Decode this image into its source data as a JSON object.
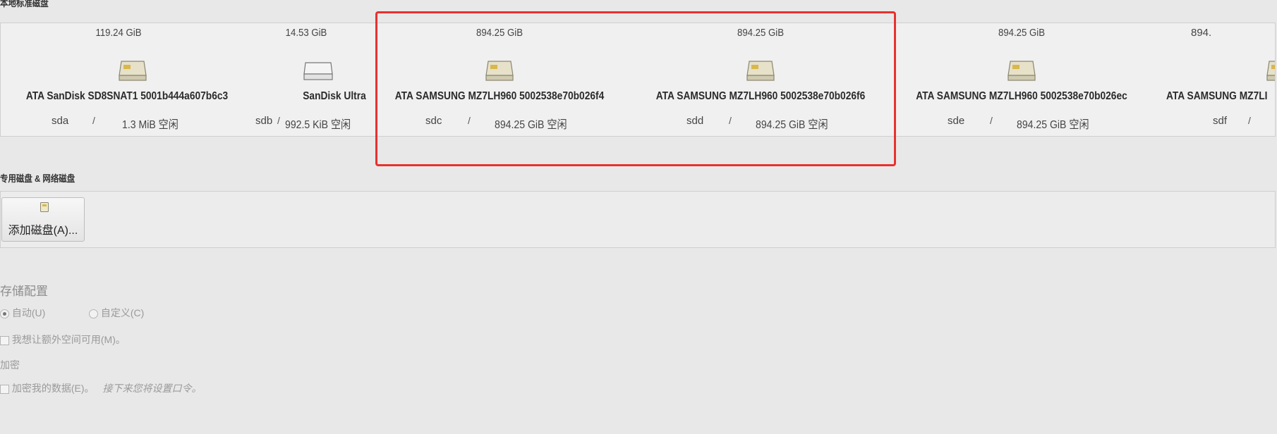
{
  "local_disks_title": "本地标准磁盘",
  "disks": [
    {
      "size": "119.24 GiB",
      "name": "ATA SanDisk SD8SNAT1 5001b444a607b6c3",
      "dev": "sda",
      "sep": "/",
      "free": "1.3 MiB 空闲",
      "icon": "hard-drive-icon"
    },
    {
      "size": "14.53 GiB",
      "name": "SanDisk Ultra",
      "dev": "sdb",
      "sep": "/",
      "free": "992.5 KiB 空闲",
      "icon": "usb-drive-icon"
    },
    {
      "size": "894.25 GiB",
      "name": "ATA SAMSUNG MZ7LH960 5002538e70b026f4",
      "dev": "sdc",
      "sep": "/",
      "free": "894.25 GiB 空闲",
      "icon": "hard-drive-icon"
    },
    {
      "size": "894.25 GiB",
      "name": "ATA SAMSUNG MZ7LH960 5002538e70b026f6",
      "dev": "sdd",
      "sep": "/",
      "free": "894.25 GiB 空闲",
      "icon": "hard-drive-icon"
    },
    {
      "size": "894.25 GiB",
      "name": "ATA SAMSUNG MZ7LH960 5002538e70b026ec",
      "dev": "sde",
      "sep": "/",
      "free": "894.25 GiB 空闲",
      "icon": "hard-drive-icon"
    },
    {
      "size": "894.",
      "name": "ATA SAMSUNG MZ7LI",
      "dev": "sdf",
      "sep": "/",
      "free": "",
      "icon": "hard-drive-icon"
    }
  ],
  "special_disks_title": "专用磁盘 & 网络磁盘",
  "add_disk_label": "添加磁盘(A)...",
  "storage_config_title": "存储配置",
  "radio_auto": "自动(U)",
  "radio_custom": "自定义(C)",
  "extra_space_label": "我想让额外空间可用(M)。",
  "encryption_title": "加密",
  "encrypt_label": "加密我的数据(E)。",
  "encrypt_hint": "接下来您将设置口令。",
  "colors": {
    "highlight": "#e8312f",
    "background": "#e8e8e8",
    "strip": "#f0f0f0"
  }
}
